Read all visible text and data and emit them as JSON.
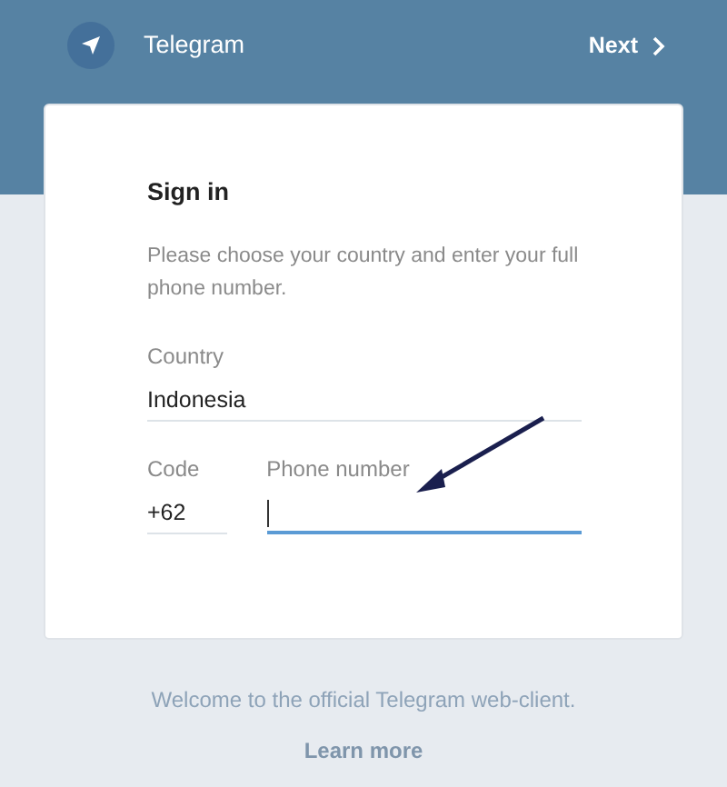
{
  "header": {
    "title": "Telegram",
    "next": {
      "label": "Next"
    }
  },
  "card": {
    "title": "Sign in",
    "description": "Please choose your country and enter your full phone number.",
    "fields": [
      {
        "kind": "country",
        "label": "Country",
        "value": "Indonesia",
        "focused": false
      },
      {
        "kind": "code",
        "label": "Code",
        "value": "+62",
        "focused": false
      },
      {
        "kind": "phone",
        "label": "Phone number",
        "focused": true
      }
    ]
  },
  "footer": {
    "text": "Welcome to the official Telegram web-client.",
    "link": "Learn more"
  }
}
